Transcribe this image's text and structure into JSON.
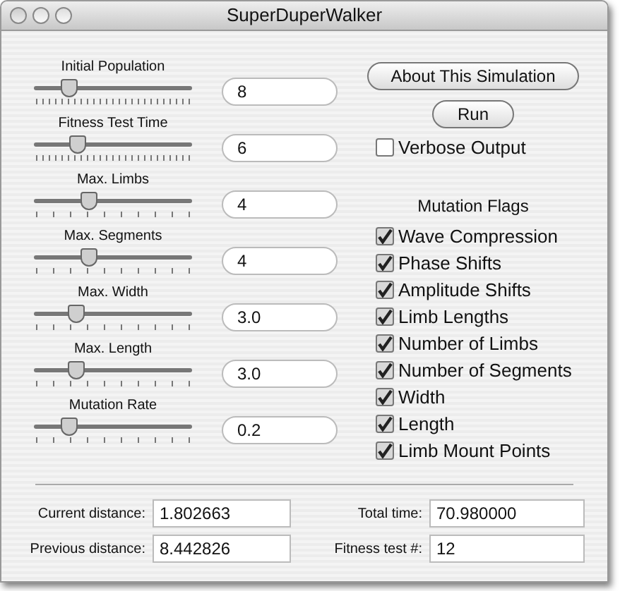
{
  "window": {
    "title": "SuperDuperWalker"
  },
  "sliders": [
    {
      "label": "Initial Population",
      "level": 0.22,
      "kind": "fine",
      "value": "8"
    },
    {
      "label": "Fitness Test Time",
      "level": 0.28,
      "kind": "fine",
      "value": "6"
    },
    {
      "label": "Max. Limbs",
      "level": 0.35,
      "kind": "coarse",
      "value": "4"
    },
    {
      "label": "Max. Segments",
      "level": 0.35,
      "kind": "coarse",
      "value": "4"
    },
    {
      "label": "Max. Width",
      "level": 0.27,
      "kind": "coarse",
      "value": "3.0"
    },
    {
      "label": "Max. Length",
      "level": 0.27,
      "kind": "coarse",
      "value": "3.0"
    },
    {
      "label": "Mutation Rate",
      "level": 0.22,
      "kind": "coarse",
      "value": "0.2"
    }
  ],
  "buttons": [
    "About This Simulation",
    "Run"
  ],
  "verbose": {
    "label": "Verbose Output",
    "checked": false
  },
  "mutation_flags": {
    "title": "Mutation Flags",
    "items": [
      {
        "label": "Wave Compression",
        "checked": true
      },
      {
        "label": "Phase Shifts",
        "checked": true
      },
      {
        "label": "Amplitude Shifts",
        "checked": true
      },
      {
        "label": "Limb Lengths",
        "checked": true
      },
      {
        "label": "Number of Limbs",
        "checked": true
      },
      {
        "label": "Number of Segments",
        "checked": true
      },
      {
        "label": "Width",
        "checked": true
      },
      {
        "label": "Length",
        "checked": true
      },
      {
        "label": "Limb Mount Points",
        "checked": true
      }
    ]
  },
  "stats": [
    {
      "label": "Current distance:",
      "value": "1.802663"
    },
    {
      "label": "Total time:",
      "value": "70.980000"
    },
    {
      "label": "Previous distance:",
      "value": "8.442826"
    },
    {
      "label": "Fitness test #:",
      "value": "12"
    }
  ]
}
